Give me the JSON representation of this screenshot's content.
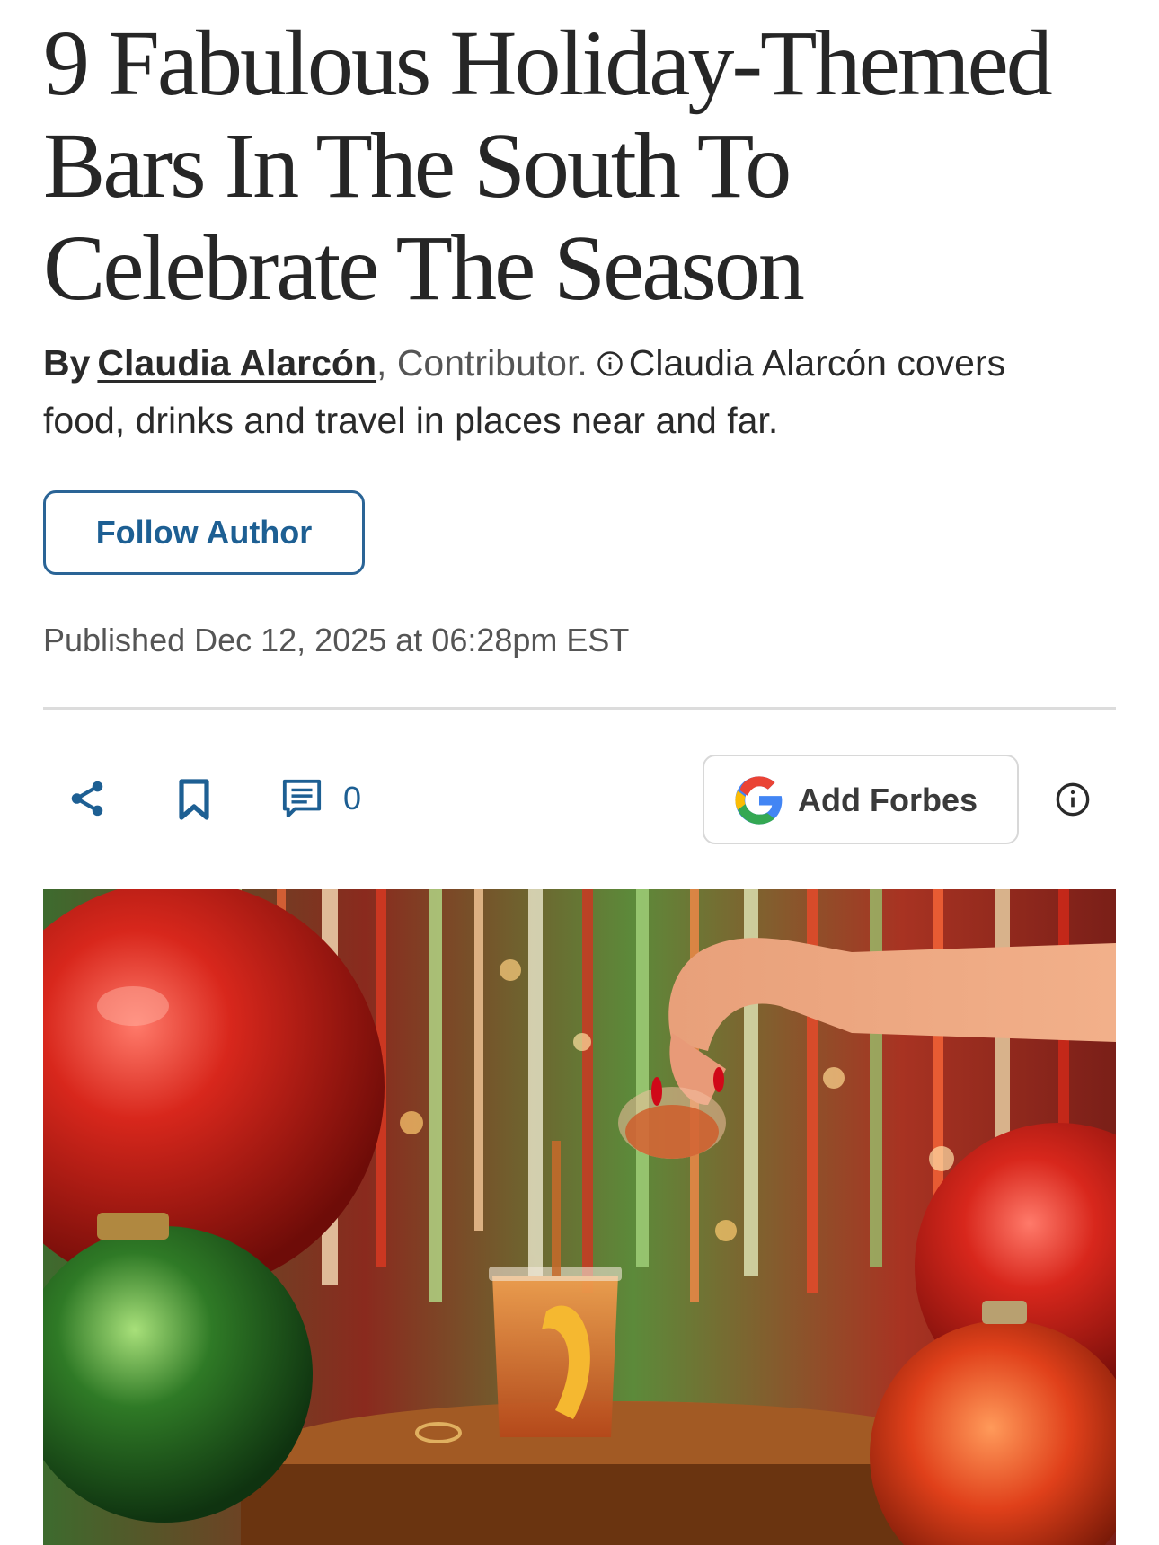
{
  "article": {
    "headline": "9 Fabulous Holiday-Themed Bars In The South To Celebrate The Season",
    "byline": {
      "prefix": "By",
      "author": "Claudia Alarcón",
      "role": ", Contributor.",
      "bio": "Claudia Alarcón covers food, drinks and travel in places near and far."
    },
    "follow_label": "Follow Author",
    "published": "Published Dec 12, 2025 at 06:28pm EST"
  },
  "actions": {
    "comment_count": "0",
    "add_forbes_label": "Add Forbes"
  },
  "icons": {
    "share": "share-icon",
    "bookmark": "bookmark-icon",
    "comments": "comment-icon",
    "google": "google-logo-icon",
    "info": "info-icon"
  },
  "colors": {
    "accent": "#1d5f93",
    "headline": "#262626",
    "divider": "#dcdcdc"
  }
}
